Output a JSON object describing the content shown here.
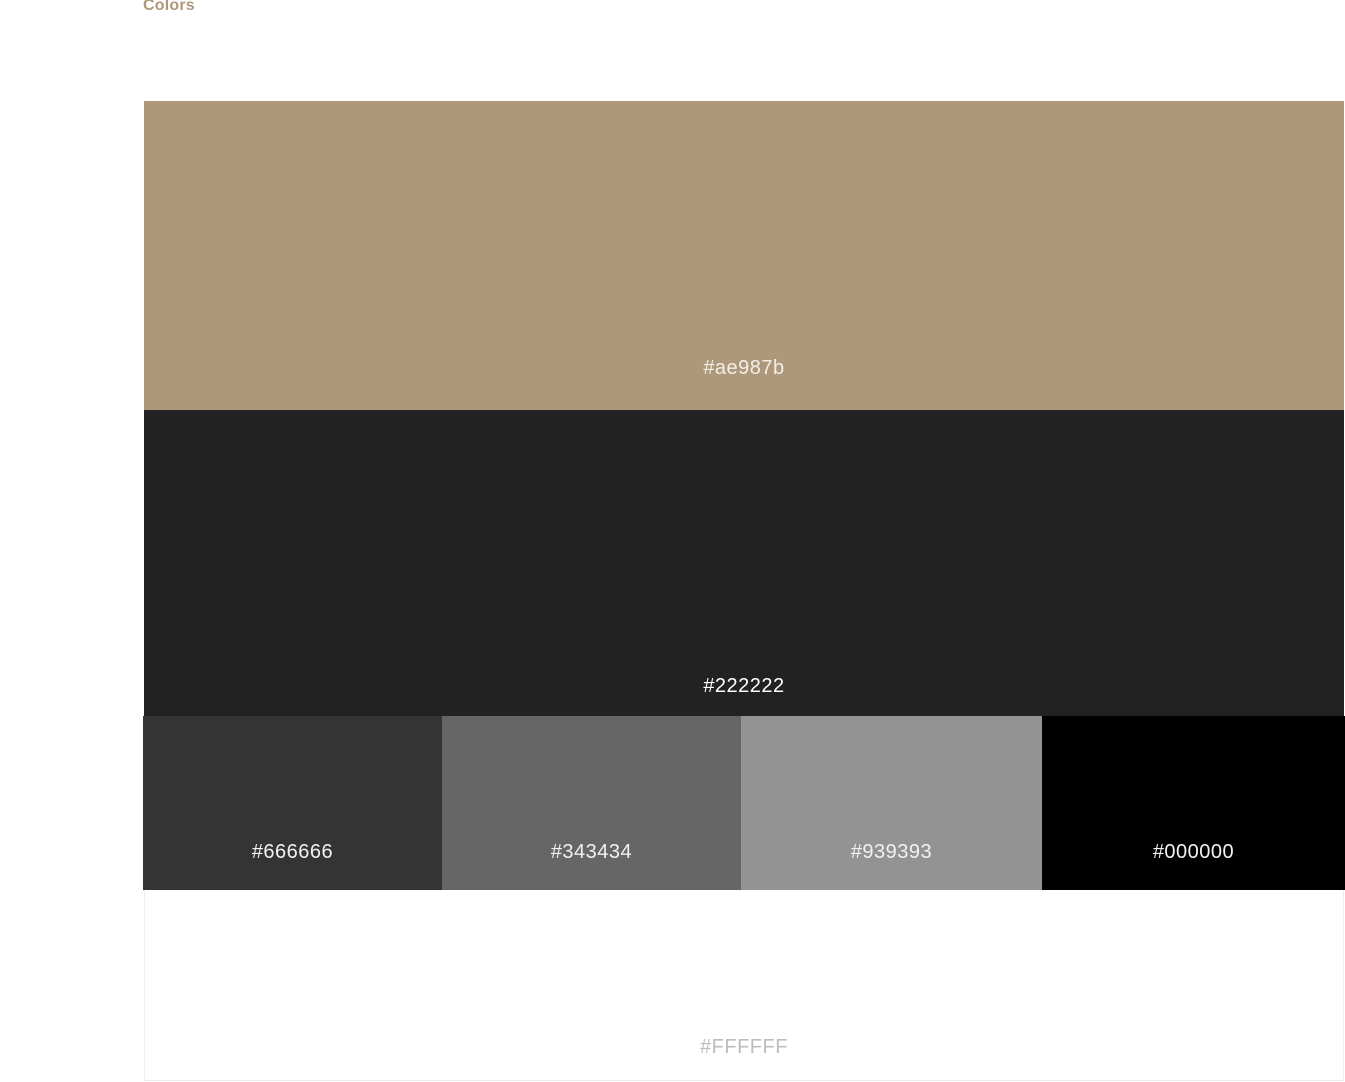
{
  "section": {
    "title": "Colors"
  },
  "palette": {
    "primary": {
      "label": "#ae987b",
      "color": "#ae987b"
    },
    "dark": {
      "label": "#222222",
      "color": "#222222"
    },
    "row": [
      {
        "label": "#666666",
        "color": "#343434"
      },
      {
        "label": "#343434",
        "color": "#666666"
      },
      {
        "label": "#939393",
        "color": "#939393"
      },
      {
        "label": "#000000",
        "color": "#000000"
      }
    ],
    "white": {
      "label": "#FFFFFF",
      "color": "#ffffff"
    }
  }
}
